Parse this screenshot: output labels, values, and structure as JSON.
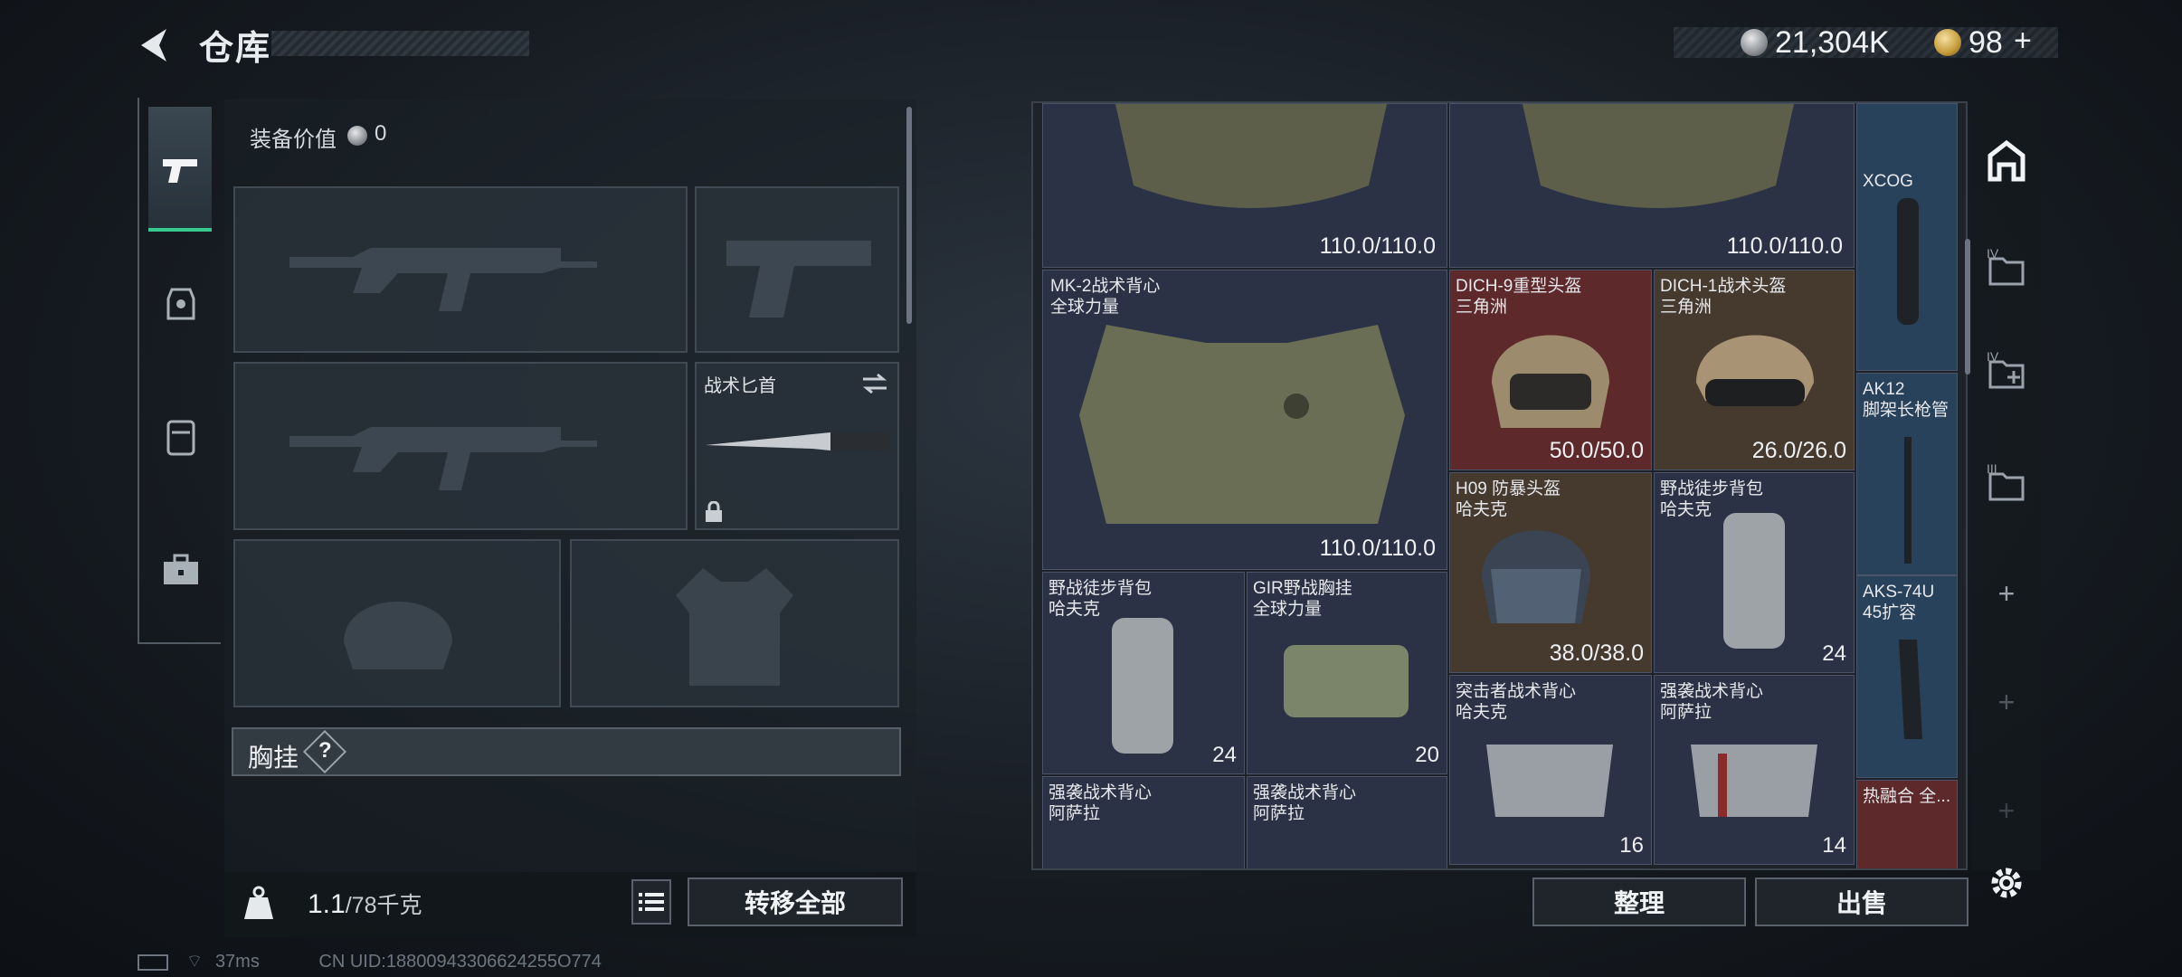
{
  "header": {
    "title": "仓库",
    "currency1": "21,304K",
    "currency2": "98",
    "currency2_plus": "+"
  },
  "loadout": {
    "equipment_value_label": "装备价值",
    "equipment_value": "0",
    "knife_label": "战术匕首",
    "chest_rig_label": "胸挂",
    "chest_rig_help": "?",
    "weight_current": "1.1",
    "weight_max": "/78千克",
    "transfer_all": "转移全部"
  },
  "stash": {
    "top_left_durability": "110.0/110.0",
    "top_mid_durability": "110.0/110.0",
    "items": [
      {
        "name1": "MK-2战术背心",
        "name2": "全球力量",
        "durability": "110.0/110.0"
      },
      {
        "name1": "DICH-9重型头盔",
        "name2": "三角洲",
        "durability": "50.0/50.0"
      },
      {
        "name1": "DICH-1战术头盔",
        "name2": "三角洲",
        "durability": "26.0/26.0"
      },
      {
        "name1": "H09 防暴头盔",
        "name2": "哈夫克",
        "durability": "38.0/38.0"
      },
      {
        "name1": "野战徒步背包",
        "name2": "哈夫克",
        "count": "24"
      },
      {
        "name1": "野战徒步背包",
        "name2": "哈夫克",
        "count": "24"
      },
      {
        "name1": "GIR野战胸挂",
        "name2": "全球力量",
        "count": "20"
      },
      {
        "name1": "突击者战术背心",
        "name2": "哈夫克",
        "count": "16"
      },
      {
        "name1": "强袭战术背心",
        "name2": "阿萨拉",
        "count": "14"
      },
      {
        "name1": "强袭战术背心",
        "name2": "阿萨拉"
      },
      {
        "name1": "强袭战术背心",
        "name2": "阿萨拉"
      }
    ],
    "side_items": [
      {
        "name1": "XCOG"
      },
      {
        "name1": "AK12",
        "name2": "脚架长枪管"
      },
      {
        "name1": "AKS-74U",
        "name2": "45扩容"
      },
      {
        "name1": "热融合 全..."
      }
    ],
    "sort_button": "整理",
    "sell_button": "出售"
  },
  "right_rail": {
    "tab1_tier": "IV",
    "tab2_tier": "IV",
    "tab3_tier": "III",
    "add1": "+",
    "add2": "+",
    "add3": "+"
  },
  "status": {
    "ping": "37ms",
    "uid": "CN UID:18800943306624255O774"
  },
  "colors": {
    "accent_green": "#36c98d",
    "red_cell": "#702c2c",
    "cell_bg": "#2e3448"
  }
}
